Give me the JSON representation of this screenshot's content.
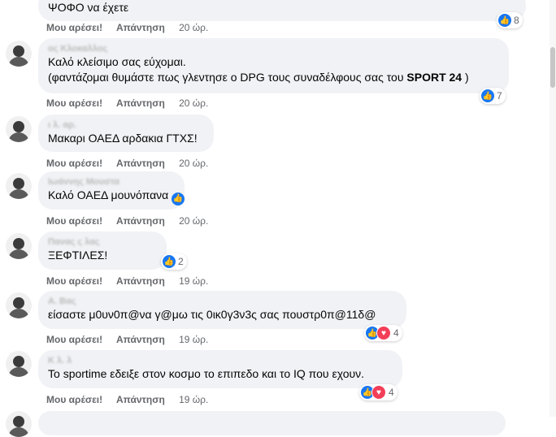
{
  "actions": {
    "like": "Μου αρέσει!",
    "reply": "Απάντηση"
  },
  "comments": [
    {
      "author": "",
      "text": "ΨΟΦΟ να έχετε",
      "time": "20 ώρ.",
      "reactions": "8"
    },
    {
      "author": "ος Κλοκαλλος",
      "line1": "Καλό κλείσιμο σας εύχομαι.",
      "line2_pre": "(φαντάζομαι θυμάστε πως γλεντησε ο DPG τους συναδέλφους σας του ",
      "line2_bold": "SPORT 24",
      "line2_post": " )",
      "time": "20 ώρ.",
      "reactions": "7"
    },
    {
      "author": "ι λ. αρ.",
      "text": "Μακαρι ΟΑΕΔ αρδακια ΓΤΧΣ!",
      "time": "20 ώρ."
    },
    {
      "author": "Ιωάννης Μουστα",
      "text": "Καλό ΟΑΕΔ μουνόπανα",
      "time": "20 ώρ."
    },
    {
      "author": "Πανας ς λας",
      "text": "ΞΕΦΤΙΛΕΣ!",
      "time": "19 ώρ.",
      "reactions": "2"
    },
    {
      "author": "Α. Βας",
      "text": "είσαστε μ0υν0π@να γ@μω τις 0ικ0γ3ν3ς σας πουστρ0π@11δ@",
      "time": "19 ώρ.",
      "reactions": "4"
    },
    {
      "author": "Κ λ. λ",
      "text": "Το sportime εδειξε στον κοσμο το επιπεδο και το IQ που εχουν.",
      "time": "19 ώρ.",
      "reactions": "4"
    }
  ]
}
